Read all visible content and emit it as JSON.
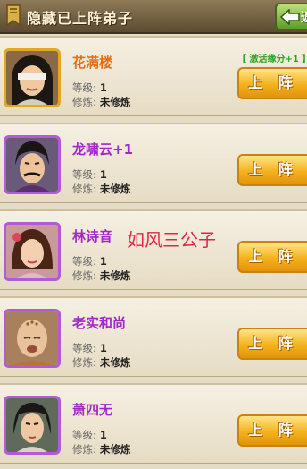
{
  "header": {
    "title": "隐藏已上阵弟子",
    "back_label": "返"
  },
  "up_button_label": "上 阵",
  "watermark": "如风三公子",
  "disciples": [
    {
      "name": "花满楼",
      "level_label": "等级:",
      "level": "1",
      "cultivation_label": "修炼:",
      "cultivation": "未修炼",
      "bonus": "【 激活缘分+1 】",
      "frame": "gold",
      "name_color": "orange"
    },
    {
      "name": "龙啸云+1",
      "level_label": "等级:",
      "level": "1",
      "cultivation_label": "修炼:",
      "cultivation": "未修炼",
      "bonus": "",
      "frame": "purple",
      "name_color": "purple"
    },
    {
      "name": "林诗音",
      "level_label": "等级:",
      "level": "1",
      "cultivation_label": "修炼:",
      "cultivation": "未修炼",
      "bonus": "",
      "frame": "purple",
      "name_color": "purple"
    },
    {
      "name": "老实和尚",
      "level_label": "等级:",
      "level": "1",
      "cultivation_label": "修炼:",
      "cultivation": "未修炼",
      "bonus": "",
      "frame": "purple",
      "name_color": "purple"
    },
    {
      "name": "萧四无",
      "level_label": "等级:",
      "level": "1",
      "cultivation_label": "修炼:",
      "cultivation": "未修炼",
      "bonus": "",
      "frame": "purple",
      "name_color": "purple"
    }
  ]
}
